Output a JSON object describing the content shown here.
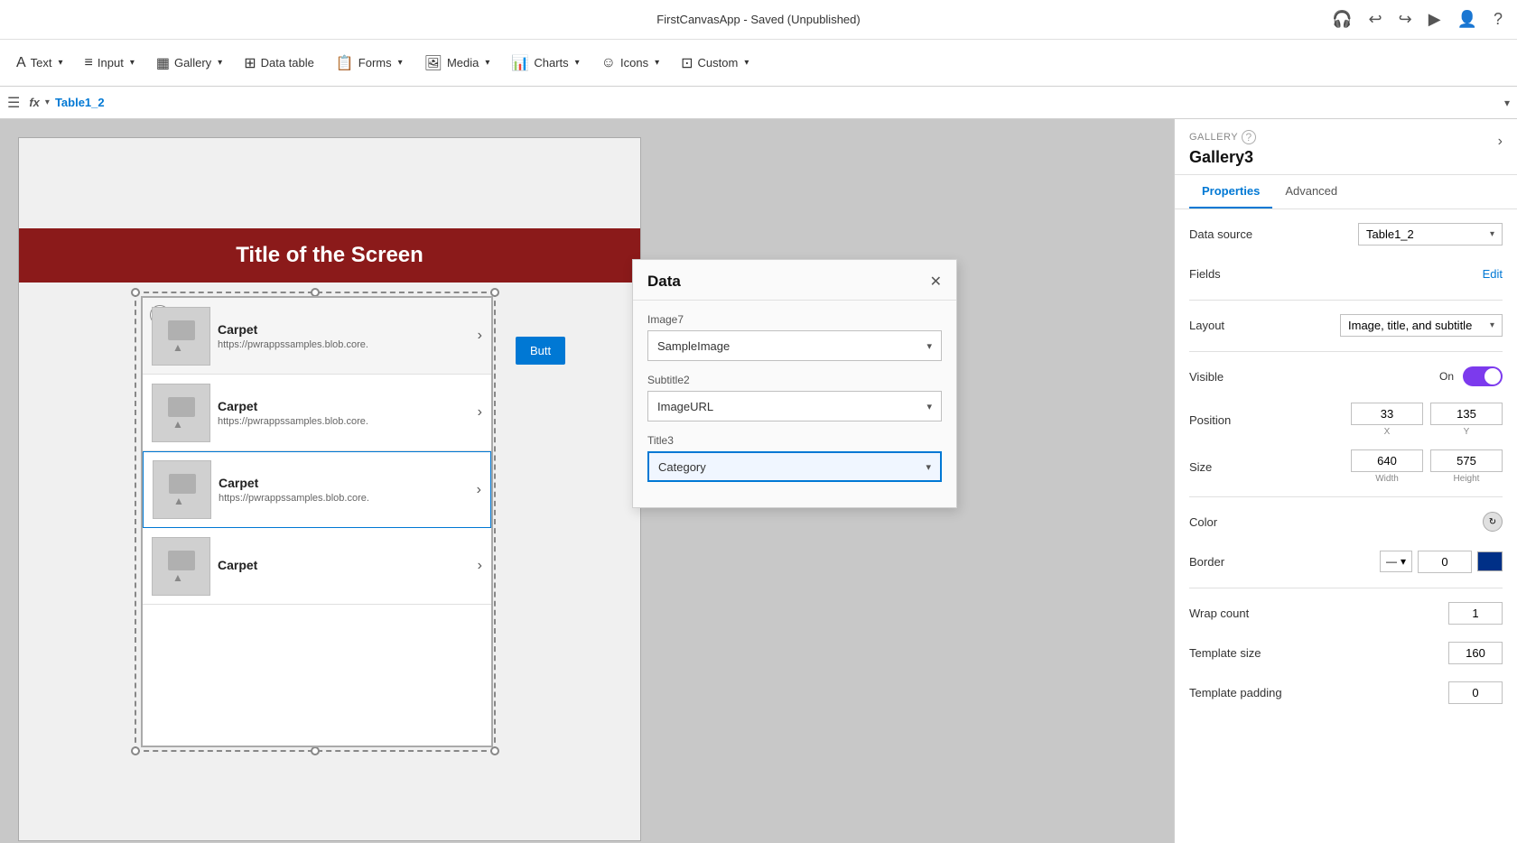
{
  "titleBar": {
    "appName": "FirstCanvasApp - Saved (Unpublished)"
  },
  "toolbar": {
    "items": [
      {
        "id": "text",
        "label": "Text",
        "icon": "T"
      },
      {
        "id": "input",
        "label": "Input",
        "icon": "≡"
      },
      {
        "id": "gallery",
        "label": "Gallery",
        "icon": "▦"
      },
      {
        "id": "datatable",
        "label": "Data table",
        "icon": "⊞"
      },
      {
        "id": "forms",
        "label": "Forms",
        "icon": "📋"
      },
      {
        "id": "media",
        "label": "Media",
        "icon": "🖼"
      },
      {
        "id": "charts",
        "label": "Charts",
        "icon": "📊"
      },
      {
        "id": "icons",
        "label": "Icons",
        "icon": "☺"
      },
      {
        "id": "custom",
        "label": "Custom",
        "icon": "⊡"
      }
    ]
  },
  "formulaBar": {
    "hamburger": "☰",
    "fxLabel": "fx",
    "formulaValue": "Table1_2"
  },
  "canvas": {
    "titleText": "Title of the Screen",
    "galleryItems": [
      {
        "title": "Carpet",
        "subtitle": "https://pwrappssamples.blob.core."
      },
      {
        "title": "Carpet",
        "subtitle": "https://pwrappssamples.blob.core."
      },
      {
        "title": "Carpet",
        "subtitle": "https://pwrappssamples.blob.core."
      },
      {
        "title": "Carpet",
        "subtitle": ""
      }
    ],
    "buttonLabel": "Butt"
  },
  "dataPanel": {
    "title": "Data",
    "fields": [
      {
        "label": "Image7",
        "value": "SampleImage",
        "highlighted": false
      },
      {
        "label": "Subtitle2",
        "value": "ImageURL",
        "highlighted": false
      },
      {
        "label": "Title3",
        "value": "Category",
        "highlighted": true
      }
    ]
  },
  "rightPanel": {
    "galleryLabel": "GALLERY",
    "galleryName": "Gallery3",
    "tabs": [
      "Properties",
      "Advanced"
    ],
    "activeTab": "Properties",
    "properties": {
      "dataSource": {
        "label": "Data source",
        "value": "Table1_2"
      },
      "fields": {
        "label": "Fields",
        "editLabel": "Edit"
      },
      "layout": {
        "label": "Layout",
        "value": "Image, title, and subtitle"
      },
      "visible": {
        "label": "Visible",
        "toggleOn": "On"
      },
      "position": {
        "label": "Position",
        "x": "33",
        "y": "135"
      },
      "size": {
        "label": "Size",
        "width": "640",
        "height": "575"
      },
      "color": {
        "label": "Color"
      },
      "border": {
        "label": "Border",
        "value": "0"
      },
      "wrapCount": {
        "label": "Wrap count",
        "value": "1"
      },
      "templateSize": {
        "label": "Template size",
        "value": "160"
      },
      "templatePadding": {
        "label": "Template padding",
        "value": "0"
      }
    }
  }
}
